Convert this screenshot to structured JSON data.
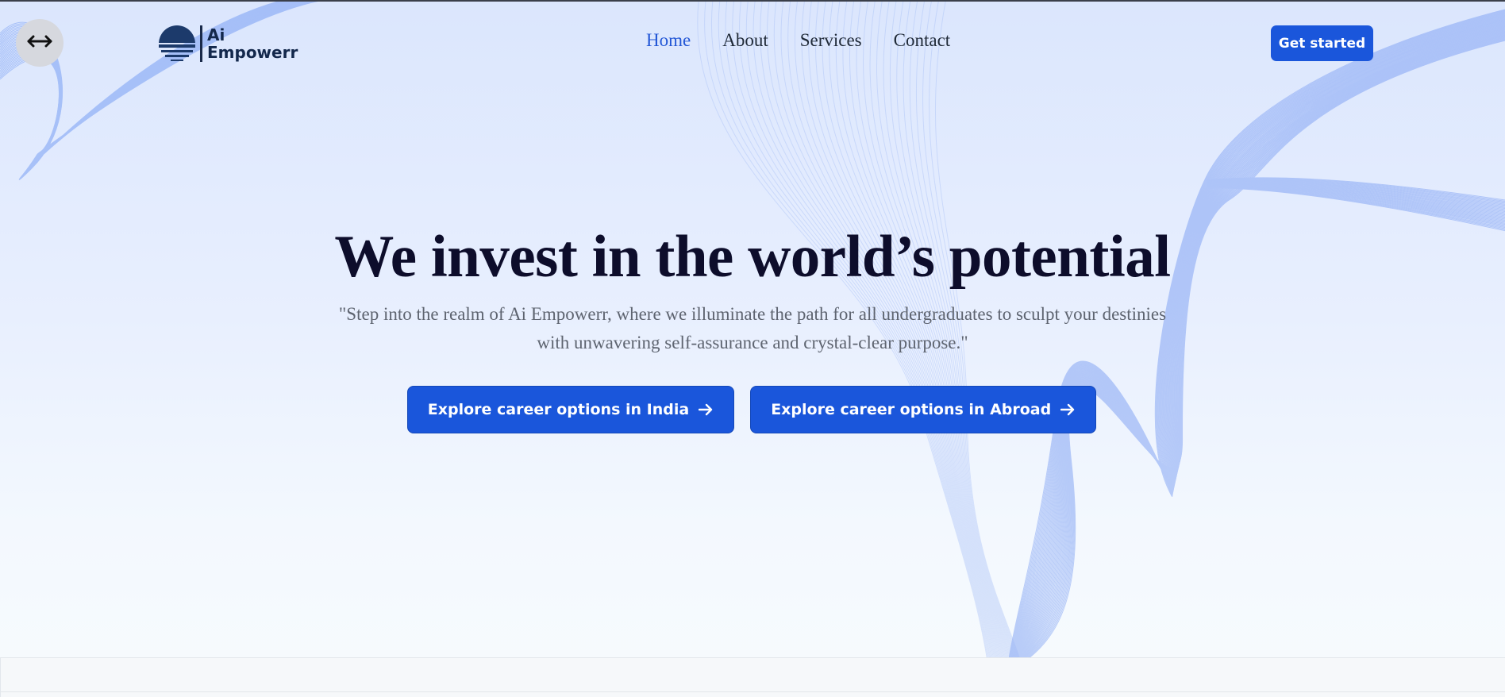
{
  "brand": {
    "name_line1": "Ai",
    "name_line2": "Empowerr"
  },
  "nav": {
    "items": [
      {
        "label": "Home",
        "active": true
      },
      {
        "label": "About",
        "active": false
      },
      {
        "label": "Services",
        "active": false
      },
      {
        "label": "Contact",
        "active": false
      }
    ],
    "cta_label": "Get started"
  },
  "hero": {
    "title": "We invest in the world’s potential",
    "subtitle": "\"Step into the realm of Ai Empowerr, where we illuminate the path for all undergraduates to sculpt your destinies with unwavering self-assurance and crystal-clear purpose.\"",
    "buttons": [
      {
        "label": "Explore career options in India",
        "icon": "arrow-right-icon"
      },
      {
        "label": "Explore career options in Abroad",
        "icon": "arrow-right-icon"
      }
    ]
  },
  "icons": {
    "toggle": "horizontal-arrows-icon"
  },
  "colors": {
    "accent": "#1a56db",
    "nav_active": "#2357d6",
    "heading": "#0d0d2b",
    "body_text": "#5e6470",
    "wave_lines": "#6f95f2"
  }
}
